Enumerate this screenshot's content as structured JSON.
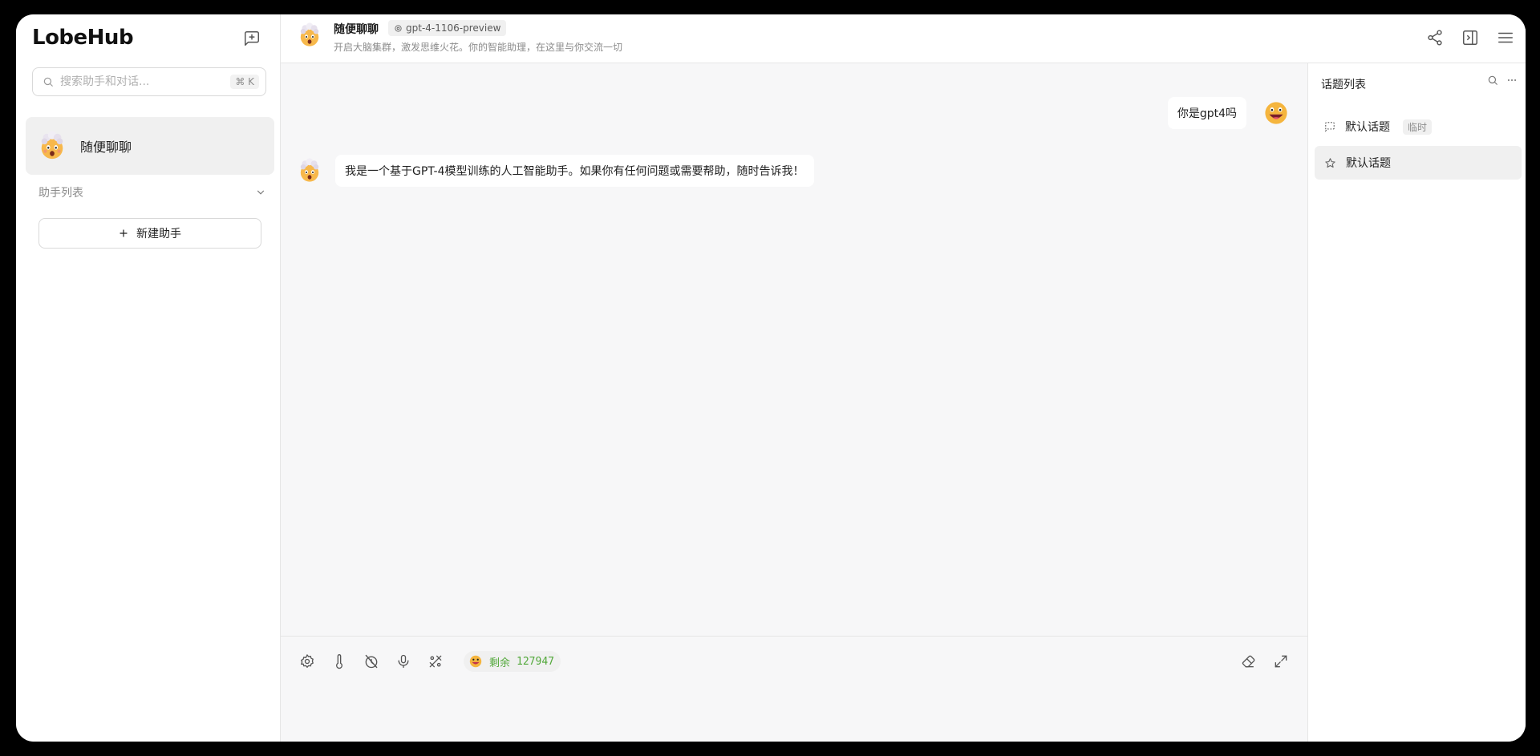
{
  "app": {
    "brand": "LobeHub"
  },
  "sidebar": {
    "search": {
      "placeholder": "搜索助手和对话...",
      "shortcut": "⌘ K"
    },
    "sessions": [
      {
        "label": "随便聊聊",
        "avatar_icon": "mind-blown-emoji-icon"
      }
    ],
    "group_label": "助手列表",
    "add_assistant_label": "新建助手"
  },
  "header": {
    "title": "随便聊聊",
    "model": "gpt-4-1106-preview",
    "description": "开启大脑集群，激发思维火花。你的智能助理，在这里与你交流一切"
  },
  "messages": [
    {
      "role": "user",
      "text": "你是gpt4吗",
      "avatar_icon": "grinning-face-emoji-icon"
    },
    {
      "role": "assistant",
      "text": "我是一个基于GPT-4模型训练的人工智能助手。如果你有任何问题或需要帮助，随时告诉我！",
      "avatar_icon": "mind-blown-emoji-icon"
    }
  ],
  "input": {
    "token_label": "剩余",
    "token_value": "127947",
    "tools": [
      "settings-icon",
      "temperature-icon",
      "history-off-icon",
      "microphone-icon",
      "tools-icon"
    ]
  },
  "topics": {
    "title": "话题列表",
    "items": [
      {
        "label": "默认话题",
        "tag": "临时",
        "icon": "message-square-dashed-icon"
      },
      {
        "label": "默认话题",
        "tag": "",
        "icon": "star-icon"
      }
    ]
  },
  "colors": {
    "accent_green": "#52a83a",
    "selected_bg": "#f0f0f0",
    "chat_bg": "#f7f7f8"
  }
}
